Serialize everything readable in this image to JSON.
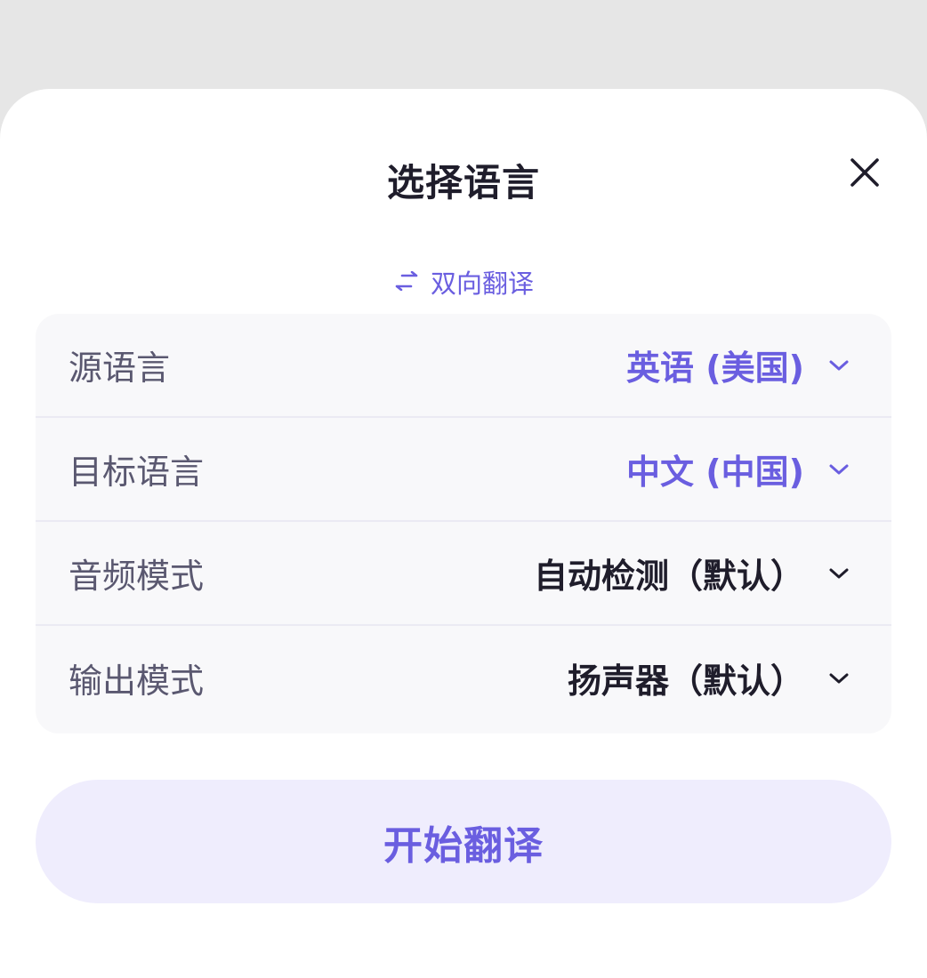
{
  "dialog": {
    "title": "选择语言",
    "bidirectional_label": "双向翻译"
  },
  "settings": [
    {
      "label": "源语言",
      "value": "英语 (美国)",
      "accent": true
    },
    {
      "label": "目标语言",
      "value": "中文 (中国)",
      "accent": true
    },
    {
      "label": "音频模式",
      "value": "自动检测（默认）",
      "accent": false
    },
    {
      "label": "输出模式",
      "value": "扬声器（默认）",
      "accent": false
    }
  ],
  "start_button": {
    "label": "开始翻译"
  },
  "icons": {
    "close": "close-icon",
    "swap": "swap-arrows-icon",
    "chevron": "chevron-down-icon"
  },
  "colors": {
    "accent": "#6a5ee0",
    "text_dark": "#1f1d2b",
    "label_gray": "#5a5870",
    "button_bg": "#efedfd",
    "panel_bg": "#f8f8fa"
  }
}
